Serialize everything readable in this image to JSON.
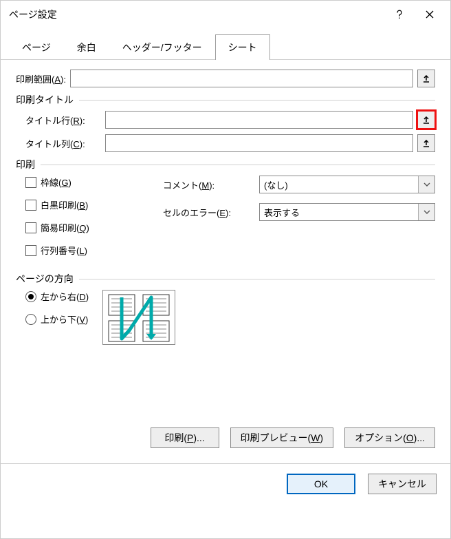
{
  "window": {
    "title": "ページ設定"
  },
  "tabs": {
    "page": "ページ",
    "margins": "余白",
    "headerFooter": "ヘッダー/フッター",
    "sheet": "シート"
  },
  "printArea": {
    "label": "印刷範囲",
    "key": "A",
    "value": ""
  },
  "printTitles": {
    "section": "印刷タイトル",
    "rowLabel": "タイトル行",
    "rowKey": "R",
    "rowValue": "",
    "colLabel": "タイトル列",
    "colKey": "C",
    "colValue": ""
  },
  "print": {
    "section": "印刷",
    "gridlines": {
      "label": "枠線",
      "key": "G"
    },
    "blackWhite": {
      "label": "白黒印刷",
      "key": "B"
    },
    "draft": {
      "label": "簡易印刷",
      "key": "Q"
    },
    "rowColHeadings": {
      "label": "行列番号",
      "key": "L"
    },
    "comments": {
      "label": "コメント",
      "key": "M",
      "value": "(なし)"
    },
    "cellErrors": {
      "label": "セルのエラー",
      "key": "E",
      "value": "表示する"
    }
  },
  "pageOrder": {
    "section": "ページの方向",
    "ltr": {
      "label": "左から右",
      "key": "D"
    },
    "ttb": {
      "label": "上から下",
      "key": "V"
    }
  },
  "buttons": {
    "print": {
      "label": "印刷",
      "key": "P",
      "suffix": "..."
    },
    "preview": {
      "label": "印刷プレビュー",
      "key": "W"
    },
    "options": {
      "label": "オプション",
      "key": "O",
      "suffix": "..."
    },
    "ok": "OK",
    "cancel": "キャンセル"
  }
}
